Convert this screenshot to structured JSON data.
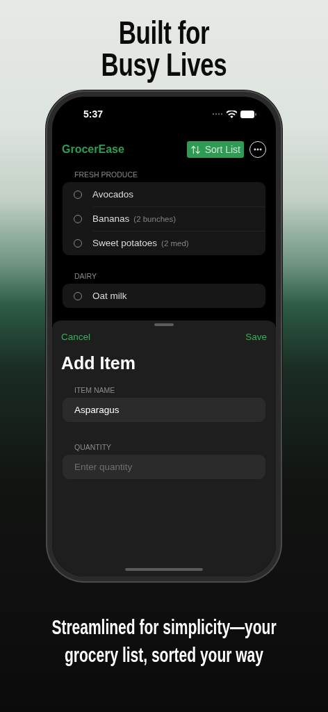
{
  "headline": "Built for Busy Lives",
  "status_bar": {
    "time": "5:37"
  },
  "app": {
    "title": "GrocerEase",
    "sort_button": "Sort List"
  },
  "sections": [
    {
      "title": "FRESH PRODUCE",
      "items": [
        {
          "name": "Avocados",
          "checked": false
        },
        {
          "name": "Bananas",
          "quantity": "(2 bunches)",
          "checked": false
        },
        {
          "name": "Sweet potatoes",
          "quantity": "(2 med)",
          "checked": false
        }
      ]
    },
    {
      "title": "DAIRY",
      "items": [
        {
          "name": "Oat milk",
          "checked": false
        }
      ]
    }
  ],
  "sheet": {
    "cancel": "Cancel",
    "save": "Save",
    "title": "Add Item",
    "fields": [
      {
        "label": "ITEM NAME",
        "value": "Asparagus"
      },
      {
        "label": "QUANTITY",
        "placeholder": "Enter quantity"
      }
    ]
  },
  "tagline": "Streamlined for simplicity—your grocery list, sorted your way"
}
